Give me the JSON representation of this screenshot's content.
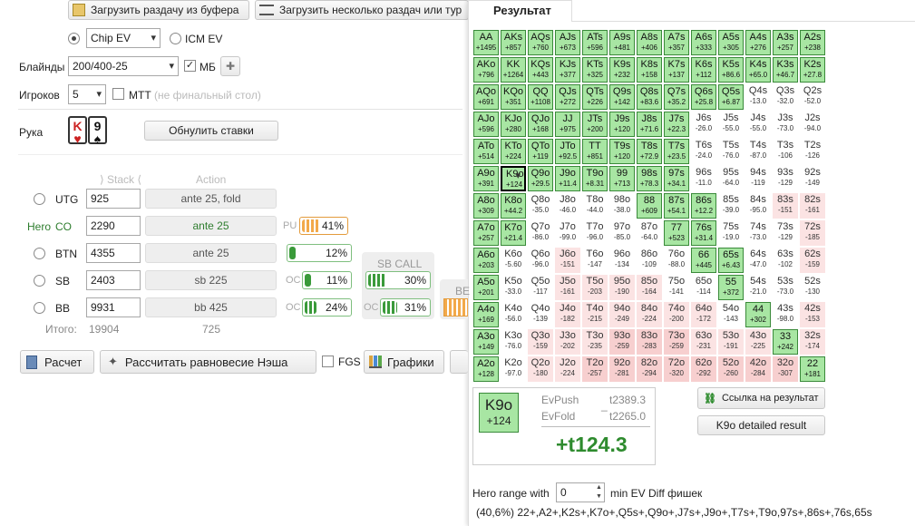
{
  "toolbar": {
    "load_buffer": "Загрузить раздачу из буфера",
    "load_multiple": "Загрузить несколько раздач или тур"
  },
  "result_tab": "Результат",
  "model": {
    "chip_ev": "Chip EV",
    "icm_ev": "ICM EV"
  },
  "blinds": {
    "label": "Блайнды",
    "value": "200/400-25",
    "mb_label": "МБ"
  },
  "players": {
    "label": "Игроков",
    "value": "5",
    "mtt_label": "МТТ",
    "mtt_note": "(не финальный стол)"
  },
  "hand": {
    "label": "Рука",
    "card1": "K",
    "card1_suit": "♥",
    "card2": "9",
    "card2_suit": "♠",
    "reset_bets": "Обнулить ставки"
  },
  "table_header": {
    "stack": "Stack",
    "action": "Action"
  },
  "positions": [
    {
      "pos": "UTG",
      "stack": "925",
      "action": "ante 25, fold"
    },
    {
      "pos": "CO",
      "hero": "Hero",
      "stack": "2290",
      "action": "ante 25",
      "bar_label": "PU",
      "bar_pct": "41%",
      "bar_value": 0.41
    },
    {
      "pos": "BTN",
      "stack": "4355",
      "action": "ante 25",
      "bar_pct": "12%",
      "bar_value": 0.12
    },
    {
      "pos": "SB",
      "stack": "2403",
      "action": "sb 225",
      "oc_label": "OC",
      "bar_pct": "11%",
      "bar_value": 0.11
    },
    {
      "pos": "BB",
      "stack": "9931",
      "action": "bb 425",
      "oc_label": "OC",
      "bar_pct": "24%",
      "bar_value": 0.24
    }
  ],
  "sb_call": {
    "label": "SB CALL",
    "pct1": "30%",
    "pct1_value": 0.3,
    "oc_label": "OC",
    "pct2": "31%",
    "pct2_value": 0.31
  },
  "be_label": "BE",
  "totals": {
    "label": "Итого:",
    "stack": "19904",
    "pot": "725"
  },
  "bottom_buttons": {
    "calc": "Расчет",
    "nash": "Рассчитать равновесие Нэша",
    "fgs": "FGS",
    "graphs": "Графики"
  },
  "grid": [
    [
      [
        "AA",
        "+1495"
      ],
      [
        "AKs",
        "+857"
      ],
      [
        "AQs",
        "+760"
      ],
      [
        "AJs",
        "+673"
      ],
      [
        "ATs",
        "+596"
      ],
      [
        "A9s",
        "+481"
      ],
      [
        "A8s",
        "+406"
      ],
      [
        "A7s",
        "+357"
      ],
      [
        "A6s",
        "+333"
      ],
      [
        "A5s",
        "+305"
      ],
      [
        "A4s",
        "+276"
      ],
      [
        "A3s",
        "+257"
      ],
      [
        "A2s",
        "+238"
      ]
    ],
    [
      [
        "AKo",
        "+796"
      ],
      [
        "KK",
        "+1264"
      ],
      [
        "KQs",
        "+443"
      ],
      [
        "KJs",
        "+377"
      ],
      [
        "KTs",
        "+325"
      ],
      [
        "K9s",
        "+232"
      ],
      [
        "K8s",
        "+158"
      ],
      [
        "K7s",
        "+137"
      ],
      [
        "K6s",
        "+112"
      ],
      [
        "K5s",
        "+86.6"
      ],
      [
        "K4s",
        "+65.0"
      ],
      [
        "K3s",
        "+46.7"
      ],
      [
        "K2s",
        "+27.8"
      ]
    ],
    [
      [
        "AQo",
        "+691"
      ],
      [
        "KQo",
        "+351"
      ],
      [
        "QQ",
        "+1108"
      ],
      [
        "QJs",
        "+272"
      ],
      [
        "QTs",
        "+226"
      ],
      [
        "Q9s",
        "+142"
      ],
      [
        "Q8s",
        "+83.6"
      ],
      [
        "Q7s",
        "+35.2"
      ],
      [
        "Q6s",
        "+25.8"
      ],
      [
        "Q5s",
        "+6.87"
      ],
      [
        "Q4s",
        "-13.0"
      ],
      [
        "Q3s",
        "-32.0"
      ],
      [
        "Q2s",
        "-52.0"
      ]
    ],
    [
      [
        "AJo",
        "+596"
      ],
      [
        "KJo",
        "+280"
      ],
      [
        "QJo",
        "+168"
      ],
      [
        "JJ",
        "+975"
      ],
      [
        "JTs",
        "+200"
      ],
      [
        "J9s",
        "+120"
      ],
      [
        "J8s",
        "+71.6"
      ],
      [
        "J7s",
        "+22.3"
      ],
      [
        "J6s",
        "-26.0"
      ],
      [
        "J5s",
        "-55.0"
      ],
      [
        "J4s",
        "-55.0"
      ],
      [
        "J3s",
        "-73.0"
      ],
      [
        "J2s",
        "-94.0"
      ]
    ],
    [
      [
        "ATo",
        "+514"
      ],
      [
        "KTo",
        "+224"
      ],
      [
        "QTo",
        "+119"
      ],
      [
        "JTo",
        "+92.5"
      ],
      [
        "TT",
        "+851"
      ],
      [
        "T9s",
        "+120"
      ],
      [
        "T8s",
        "+72.9"
      ],
      [
        "T7s",
        "+23.5"
      ],
      [
        "T6s",
        "-24.0"
      ],
      [
        "T5s",
        "-76.0"
      ],
      [
        "T4s",
        "-87.0"
      ],
      [
        "T3s",
        "-106"
      ],
      [
        "T2s",
        "-126"
      ]
    ],
    [
      [
        "A9o",
        "+391"
      ],
      [
        "K9o",
        "+124"
      ],
      [
        "Q9o",
        "+29.5"
      ],
      [
        "J9o",
        "+11.4"
      ],
      [
        "T9o",
        "+8.31"
      ],
      [
        "99",
        "+713"
      ],
      [
        "98s",
        "+78.3"
      ],
      [
        "97s",
        "+34.1"
      ],
      [
        "96s",
        "-11.0"
      ],
      [
        "95s",
        "-64.0"
      ],
      [
        "94s",
        "-119"
      ],
      [
        "93s",
        "-129"
      ],
      [
        "92s",
        "-149"
      ]
    ],
    [
      [
        "A8o",
        "+309"
      ],
      [
        "K8o",
        "+44.2"
      ],
      [
        "Q8o",
        "-35.0"
      ],
      [
        "J8o",
        "-46.0"
      ],
      [
        "T8o",
        "-44.0"
      ],
      [
        "98o",
        "-38.0"
      ],
      [
        "88",
        "+609"
      ],
      [
        "87s",
        "+54.1"
      ],
      [
        "86s",
        "+12.2"
      ],
      [
        "85s",
        "-39.0"
      ],
      [
        "84s",
        "-95.0"
      ],
      [
        "83s",
        "-151"
      ],
      [
        "82s",
        "-161"
      ]
    ],
    [
      [
        "A7o",
        "+257"
      ],
      [
        "K7o",
        "+21.4"
      ],
      [
        "Q7o",
        "-86.0"
      ],
      [
        "J7o",
        "-99.0"
      ],
      [
        "T7o",
        "-96.0"
      ],
      [
        "97o",
        "-85.0"
      ],
      [
        "87o",
        "-64.0"
      ],
      [
        "77",
        "+523"
      ],
      [
        "76s",
        "+31.4"
      ],
      [
        "75s",
        "-19.0"
      ],
      [
        "74s",
        "-73.0"
      ],
      [
        "73s",
        "-129"
      ],
      [
        "72s",
        "-185"
      ]
    ],
    [
      [
        "A6o",
        "+203"
      ],
      [
        "K6o",
        "-5.60"
      ],
      [
        "Q6o",
        "-96.0"
      ],
      [
        "J6o",
        "-151"
      ],
      [
        "T6o",
        "-147"
      ],
      [
        "96o",
        "-134"
      ],
      [
        "86o",
        "-109"
      ],
      [
        "76o",
        "-88.0"
      ],
      [
        "66",
        "+445"
      ],
      [
        "65s",
        "+6.43"
      ],
      [
        "64s",
        "-47.0"
      ],
      [
        "63s",
        "-102"
      ],
      [
        "62s",
        "-159"
      ]
    ],
    [
      [
        "A5o",
        "+201"
      ],
      [
        "K5o",
        "-33.0"
      ],
      [
        "Q5o",
        "-117"
      ],
      [
        "J5o",
        "-161"
      ],
      [
        "T5o",
        "-203"
      ],
      [
        "95o",
        "-190"
      ],
      [
        "85o",
        "-164"
      ],
      [
        "75o",
        "-141"
      ],
      [
        "65o",
        "-114"
      ],
      [
        "55",
        "+372"
      ],
      [
        "54s",
        "-21.0"
      ],
      [
        "53s",
        "-73.0"
      ],
      [
        "52s",
        "-130"
      ]
    ],
    [
      [
        "A4o",
        "+169"
      ],
      [
        "K4o",
        "-56.0"
      ],
      [
        "Q4o",
        "-139"
      ],
      [
        "J4o",
        "-182"
      ],
      [
        "T4o",
        "-215"
      ],
      [
        "94o",
        "-249"
      ],
      [
        "84o",
        "-224"
      ],
      [
        "74o",
        "-200"
      ],
      [
        "64o",
        "-172"
      ],
      [
        "54o",
        "-143"
      ],
      [
        "44",
        "+302"
      ],
      [
        "43s",
        "-98.0"
      ],
      [
        "42s",
        "-153"
      ]
    ],
    [
      [
        "A3o",
        "+149"
      ],
      [
        "K3o",
        "-76.0"
      ],
      [
        "Q3o",
        "-159"
      ],
      [
        "J3o",
        "-202"
      ],
      [
        "T3o",
        "-235"
      ],
      [
        "93o",
        "-259"
      ],
      [
        "83o",
        "-283"
      ],
      [
        "73o",
        "-259"
      ],
      [
        "63o",
        "-231"
      ],
      [
        "53o",
        "-191"
      ],
      [
        "43o",
        "-225"
      ],
      [
        "33",
        "+242"
      ],
      [
        "32s",
        "-174"
      ]
    ],
    [
      [
        "A2o",
        "+128"
      ],
      [
        "K2o",
        "-97.0"
      ],
      [
        "Q2o",
        "-180"
      ],
      [
        "J2o",
        "-224"
      ],
      [
        "T2o",
        "-257"
      ],
      [
        "92o",
        "-281"
      ],
      [
        "82o",
        "-294"
      ],
      [
        "72o",
        "-320"
      ],
      [
        "62o",
        "-292"
      ],
      [
        "52o",
        "-260"
      ],
      [
        "42o",
        "-284"
      ],
      [
        "32o",
        "-307"
      ],
      [
        "22",
        "+181"
      ]
    ]
  ],
  "selected_hand": {
    "name": "K9o",
    "value": "+124",
    "evpush_label": "EvPush",
    "evpush": "t2389.3",
    "evfold_label": "EvFold",
    "evfold": "t2265.0",
    "diff": "+t124.3",
    "dash": "_"
  },
  "link_button": "Ссылка на результат",
  "detail_button": "K9o detailed result",
  "hero_range": {
    "label": "Hero range with",
    "value": "0",
    "suffix": "min EV Diff фишек",
    "range": "(40,6%) 22+,A2+,K2s+,K7o+,Q5s+,Q9o+,J7s+,J9o+,T7s+,T9o,97s+,86s+,76s,65s"
  },
  "colors": {
    "green_cell": "#a8e6a3",
    "red_cell": "#fbe3e3",
    "diff_green": "#2e8b2e",
    "hero_green": "#2e7d2e"
  }
}
